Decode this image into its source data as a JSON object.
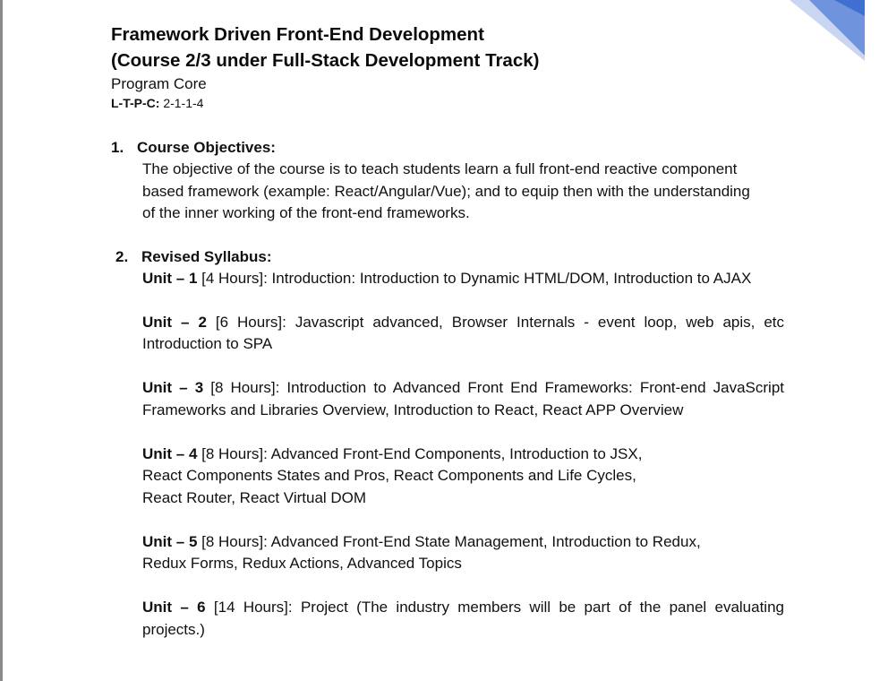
{
  "header": {
    "title_line1": "Framework Driven Front-End Development",
    "title_line2": "(Course 2/3 under Full-Stack Development Track)",
    "program": "Program Core",
    "ltpc_key": "L-T-P-C:",
    "ltpc_value": " 2-1-1-4"
  },
  "objectives": {
    "number": "1.",
    "heading": "Course Objectives:",
    "text": "The objective of the course is to teach students learn a full front-end reactive component based framework (example: React/Angular/Vue); and to equip then with the understanding of the inner working of the front-end frameworks."
  },
  "syllabus": {
    "number": "2.",
    "heading": "Revised Syllabus:",
    "units": [
      {
        "label": "Unit – 1",
        "hours": " [4 Hours]: ",
        "lines": [
          "Introduction: Introduction to Dynamic HTML/DOM, Introduction to AJAX"
        ]
      },
      {
        "label": "Unit – 2",
        "hours": " [6 Hours]: ",
        "lines": [
          "Javascript advanced, Browser Internals - event loop, web apis, etc Introduction to SPA"
        ]
      },
      {
        "label": "Unit – 3",
        "hours": " [8 Hours]: ",
        "lines": [
          "Introduction to Advanced Front End Frameworks: Front-end JavaScript Frameworks and Libraries Overview, Introduction to React, React APP Overview"
        ]
      },
      {
        "label": "Unit – 4",
        "hours": " [8 Hours]: ",
        "lines": [
          "Advanced Front-End Components, Introduction to JSX,",
          "React Components States and Pros, React Components and Life Cycles,",
          "React Router, React Virtual DOM"
        ]
      },
      {
        "label": "Unit – 5",
        "hours": " [8 Hours]: ",
        "lines": [
          "Advanced Front-End State Management, Introduction to Redux,",
          "Redux Forms, Redux Actions, Advanced Topics"
        ]
      },
      {
        "label": "Unit – 6",
        "hours": " [14 Hours]: ",
        "lines": [
          "Project (The industry members will be part of the panel evaluating projects.)"
        ]
      }
    ]
  },
  "colors": {
    "corner_dark": "#3f6fd1",
    "corner_mid": "#6f94dd",
    "corner_light": "#c9d6f2"
  }
}
